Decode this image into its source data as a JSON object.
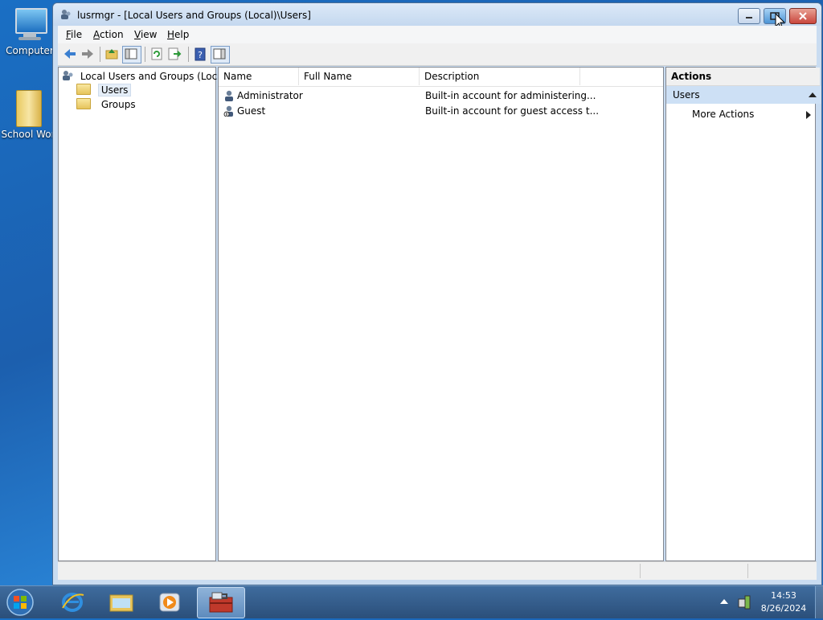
{
  "desktop": {
    "icons": [
      {
        "label": "Computer",
        "icon": "computer-icon"
      },
      {
        "label": "School Wor",
        "icon": "folder-icon"
      }
    ]
  },
  "window": {
    "title": "lusrmgr - [Local Users and Groups (Local)\\Users]",
    "menu": [
      {
        "label": "File",
        "accel": "F"
      },
      {
        "label": "Action",
        "accel": "A"
      },
      {
        "label": "View",
        "accel": "V"
      },
      {
        "label": "Help",
        "accel": "H"
      }
    ],
    "toolbar_icons": [
      "back-arrow-icon",
      "forward-arrow-icon",
      "up-folder-icon",
      "show-hide-tree-icon",
      "refresh-icon",
      "export-list-icon",
      "help-icon",
      "show-hide-action-pane-icon"
    ]
  },
  "tree": {
    "root": "Local Users and Groups (Local)",
    "items": [
      {
        "label": "Users",
        "selected": true
      },
      {
        "label": "Groups",
        "selected": false
      }
    ]
  },
  "list": {
    "columns": [
      "Name",
      "Full Name",
      "Description"
    ],
    "rows": [
      {
        "name": "Administrator",
        "full_name": "",
        "description": "Built-in account for administering..."
      },
      {
        "name": "Guest",
        "full_name": "",
        "description": "Built-in account for guest access t..."
      }
    ]
  },
  "actions": {
    "header": "Actions",
    "section": "Users",
    "items": [
      {
        "label": "More Actions"
      }
    ]
  },
  "taskbar": {
    "time": "14:53",
    "date": "8/26/2024"
  },
  "colors": {
    "desktop_bg": "#1c5fae",
    "selection": "#cde0f5",
    "close_button": "#c9463d"
  }
}
